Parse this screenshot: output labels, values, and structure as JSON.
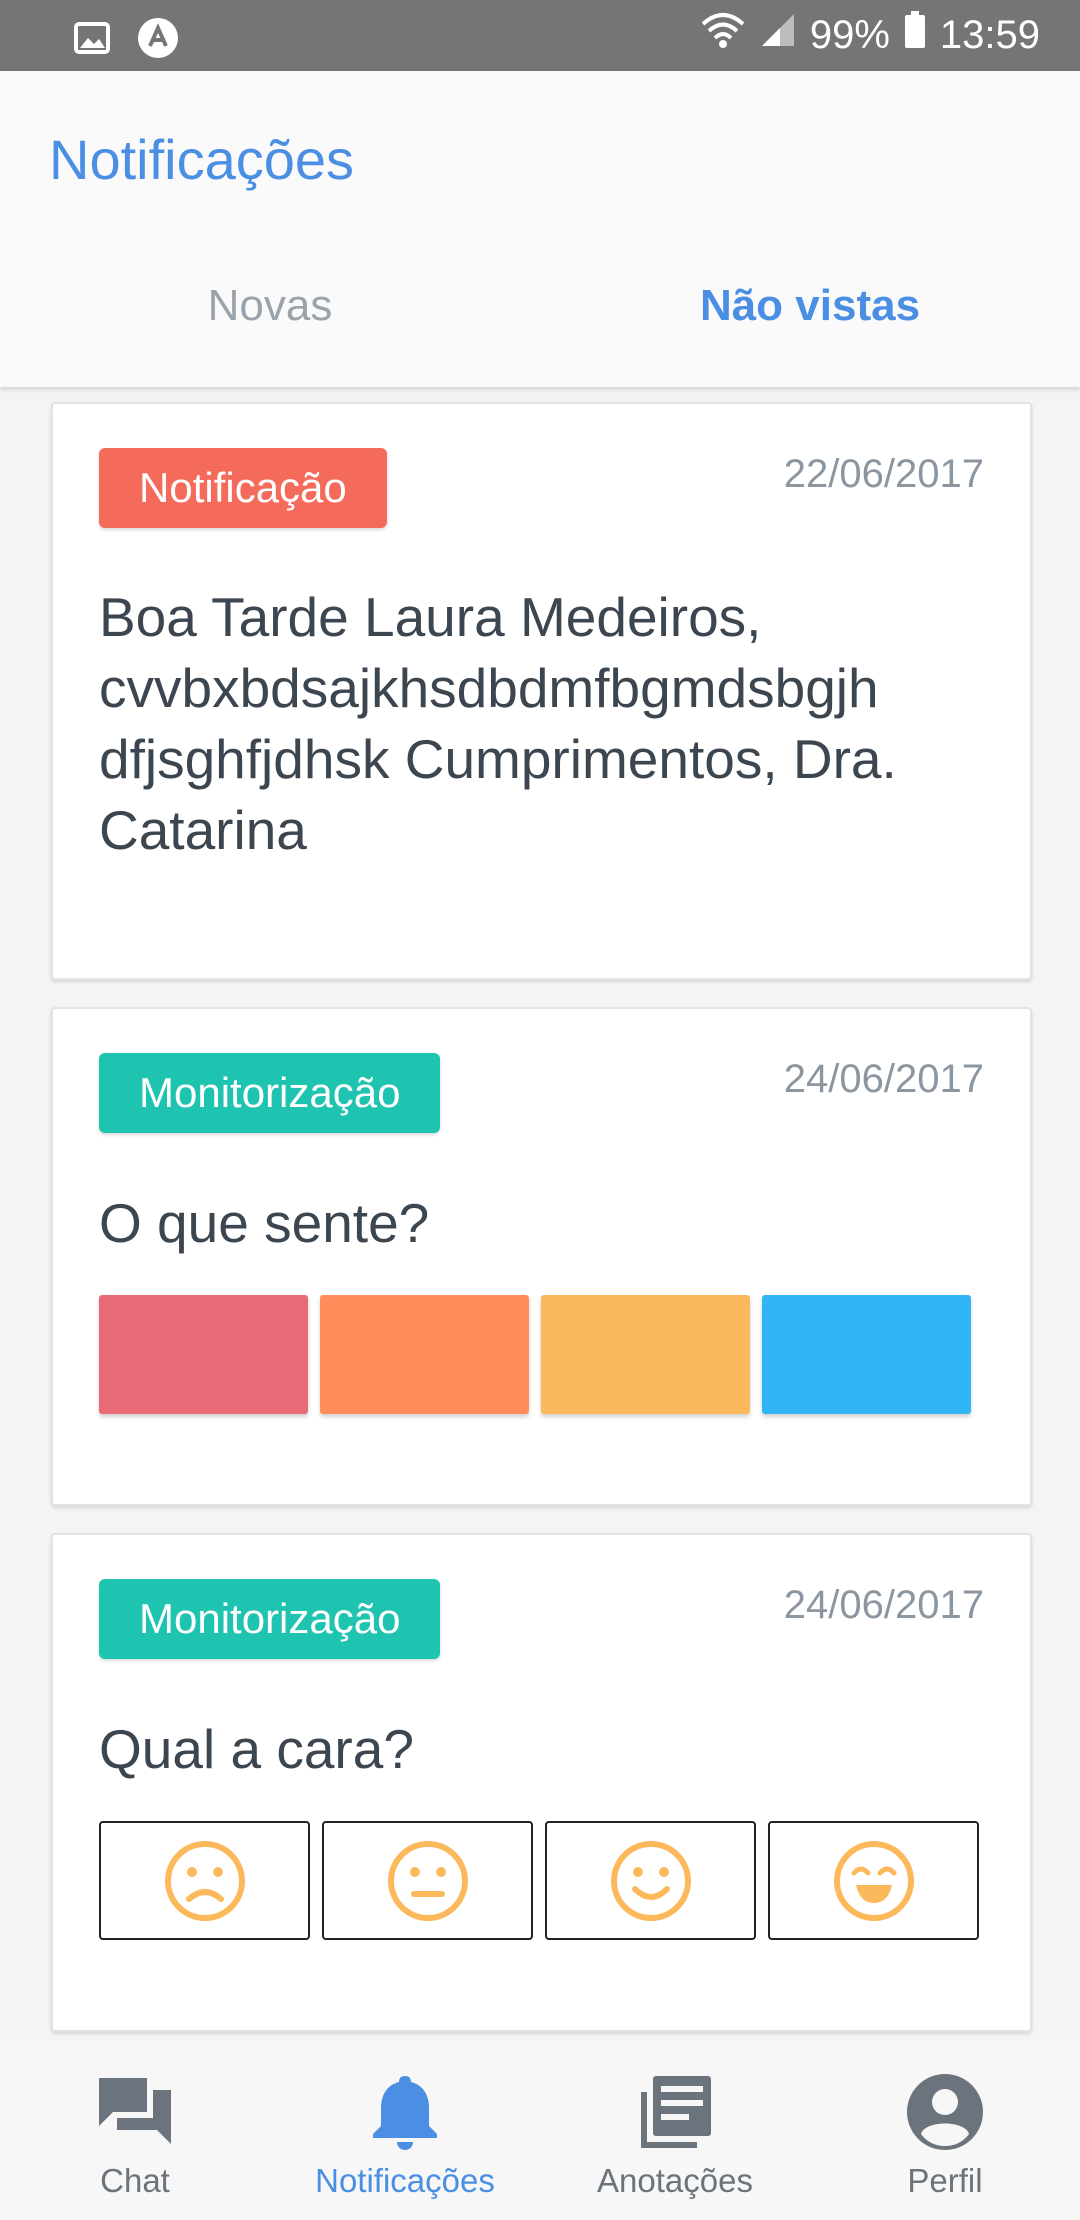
{
  "status_bar": {
    "battery": "99%",
    "time": "13:59"
  },
  "header": {
    "title": "Notificações",
    "tabs": [
      {
        "label": "Novas",
        "active": false
      },
      {
        "label": "Não vistas",
        "active": true
      }
    ]
  },
  "cards": [
    {
      "badge": "Notificação",
      "badge_color": "#f56b5b",
      "date": "22/06/2017",
      "message": "Boa Tarde Laura Medeiros, cvvbxbdsajkhsdbdmfbgmdsbgjh dfjsghfjdhsk Cumprimentos, Dra. Catarina"
    },
    {
      "badge": "Monitorização",
      "badge_color": "#1fc4b0",
      "date": "24/06/2017",
      "question": "O que sente?",
      "options": [
        "#e96b78",
        "#ff8c5a",
        "#fcb95b",
        "#32b5f5"
      ]
    },
    {
      "badge": "Monitorização",
      "badge_color": "#1fc4b0",
      "date": "24/06/2017",
      "question": "Qual a cara?",
      "options": [
        "sad-face-icon",
        "neutral-face-icon",
        "smile-face-icon",
        "grin-face-icon"
      ],
      "face_color": "#fcb95b"
    }
  ],
  "bottom_nav": [
    {
      "label": "Chat",
      "icon": "chat-icon",
      "active": false
    },
    {
      "label": "Notificações",
      "icon": "bell-icon",
      "active": true
    },
    {
      "label": "Anotações",
      "icon": "notes-icon",
      "active": false
    },
    {
      "label": "Perfil",
      "icon": "profile-icon",
      "active": false
    }
  ],
  "colors": {
    "accent": "#4a8fe3",
    "inactive_text": "#9aa3ab"
  }
}
